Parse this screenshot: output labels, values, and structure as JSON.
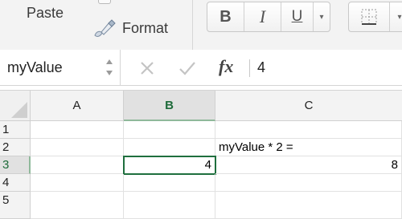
{
  "ribbon": {
    "paste_label": "Paste",
    "format_label": "Format",
    "bold_label": "B",
    "italic_label": "I",
    "underline_label": "U",
    "dropdown_glyph": "▾",
    "brush_icon": "format-painter-brush-icon",
    "border_icon": "borders-icon"
  },
  "formula_bar": {
    "name_box": "myValue",
    "fx_label": "fx",
    "formula": "4"
  },
  "grid": {
    "corner_icon": "select-all-triangle-icon",
    "columns": [
      "A",
      "B",
      "C"
    ],
    "active_column": "B",
    "rows": [
      "1",
      "2",
      "3",
      "4",
      "5"
    ],
    "active_row": "3",
    "cells": {
      "C2": "myValue * 2 =",
      "B3": "4",
      "C3": "8"
    }
  },
  "colors": {
    "accent": "#1f6f3e",
    "ribbon_bg": "#f3f3f3",
    "header_bg": "#f3f3f3"
  }
}
